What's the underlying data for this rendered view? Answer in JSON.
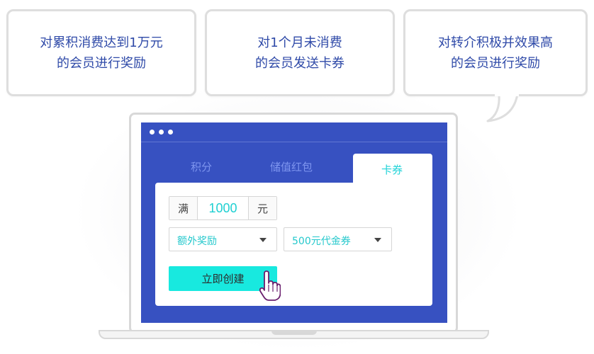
{
  "bubbles": [
    {
      "line1": "对累积消费达到1万元",
      "line2": "的会员进行奖励"
    },
    {
      "line1": "对1个月未消费",
      "line2": "的会员发送卡券"
    },
    {
      "line1": "对转介积极并效果高",
      "line2": "的会员进行奖励"
    }
  ],
  "tabs": {
    "points": "积分",
    "stored_value": "储值红包",
    "coupon": "卡券"
  },
  "form": {
    "amount_prefix": "满",
    "amount_value": "1000",
    "amount_suffix": "元",
    "reward_type": "额外奖励",
    "coupon_value": "500元代金券",
    "create_label": "立即创建"
  },
  "colors": {
    "screen": "#3751c1",
    "accent_cyan": "#18e9df",
    "bubble_text": "#2f4aa8"
  },
  "icons": [
    "window-dots-icon",
    "caret-down-icon",
    "hand-pointer-icon"
  ]
}
